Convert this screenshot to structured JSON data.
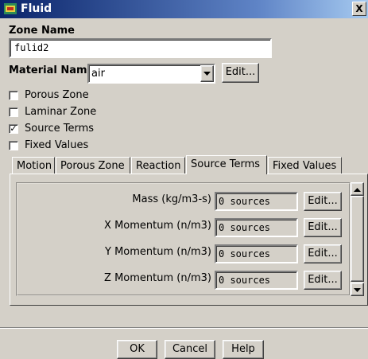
{
  "window": {
    "title": "Fluid",
    "close_glyph": "X"
  },
  "zone_name": {
    "label": "Zone Name",
    "value": "fulid2"
  },
  "material": {
    "label": "Material Name",
    "value": "air",
    "edit_label": "Edit..."
  },
  "checkboxes": [
    {
      "label": "Porous Zone",
      "checked": false
    },
    {
      "label": "Laminar Zone",
      "checked": false
    },
    {
      "label": "Source Terms",
      "checked": true
    },
    {
      "label": "Fixed Values",
      "checked": false
    }
  ],
  "check_glyph": "✓",
  "tabs": [
    {
      "label": "Motion",
      "active": false
    },
    {
      "label": "Porous Zone",
      "active": false
    },
    {
      "label": "Reaction",
      "active": false
    },
    {
      "label": "Source Terms",
      "active": true
    },
    {
      "label": "Fixed Values",
      "active": false
    }
  ],
  "source_terms": [
    {
      "label": "Mass (kg/m3-s)",
      "value": "0 sources",
      "edit_label": "Edit..."
    },
    {
      "label": "X Momentum (n/m3)",
      "value": "0 sources",
      "edit_label": "Edit..."
    },
    {
      "label": "Y Momentum (n/m3)",
      "value": "0 sources",
      "edit_label": "Edit..."
    },
    {
      "label": "Z Momentum (n/m3)",
      "value": "0 sources",
      "edit_label": "Edit..."
    }
  ],
  "buttons": {
    "ok": "OK",
    "cancel": "Cancel",
    "help": "Help"
  },
  "colors": {
    "titlebar_start": "#0a246a",
    "face": "#d4d0c8"
  }
}
